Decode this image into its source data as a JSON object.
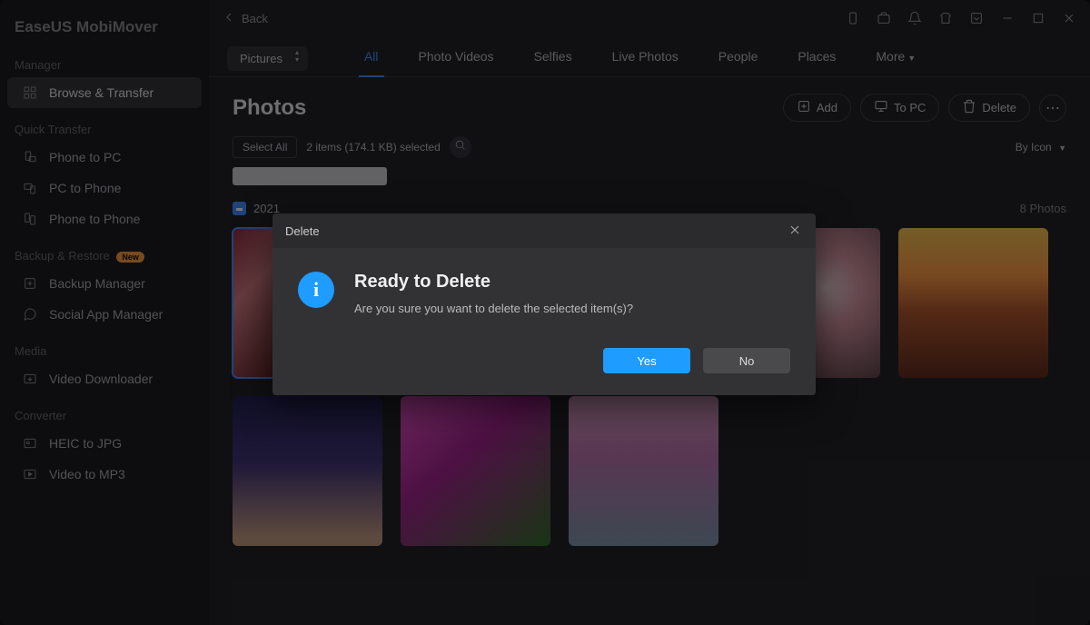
{
  "app": {
    "title": "EaseUS MobiMover",
    "back": "Back"
  },
  "sidebar": {
    "sections": {
      "manager": "Manager",
      "quick": "Quick Transfer",
      "backup": "Backup & Restore",
      "media": "Media",
      "converter": "Converter"
    },
    "items": {
      "browse": "Browse & Transfer",
      "phone_to_pc": "Phone to PC",
      "pc_to_phone": "PC to Phone",
      "phone_to_phone": "Phone to Phone",
      "backup_manager": "Backup Manager",
      "social": "Social App Manager",
      "video_dl": "Video Downloader",
      "heic": "HEIC to JPG",
      "mp3": "Video to MP3"
    },
    "new_badge": "New"
  },
  "tabs": {
    "dropdown": "Pictures",
    "all": "All",
    "photo_videos": "Photo Videos",
    "selfies": "Selfies",
    "live_photos": "Live Photos",
    "people": "People",
    "places": "Places",
    "more": "More"
  },
  "page": {
    "title": "Photos",
    "add": "Add",
    "to_pc": "To PC",
    "delete": "Delete",
    "select_all": "Select All",
    "selection_info": "2 items (174.1 KB) selected",
    "sort": "By Icon",
    "date": "2021",
    "count": "8 Photos"
  },
  "dialog": {
    "title_bar": "Delete",
    "heading": "Ready to Delete",
    "message": "Are you sure you want to delete the selected item(s)?",
    "yes": "Yes",
    "no": "No"
  }
}
